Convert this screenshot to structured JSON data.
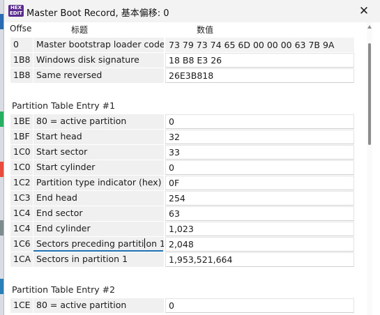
{
  "window": {
    "title": "Master Boot Record, 基本偏移: 0",
    "icon_text_top": "HEX",
    "icon_text_bottom": "EDIT",
    "close_glyph": "✕"
  },
  "columns": {
    "offset": "Offse",
    "label": "标题",
    "value": "数值"
  },
  "header_rows": [
    {
      "offset": "0",
      "label": "Master bootstrap loader code",
      "value": "73 79 73 74 65 6D 00 00 00 63 7B 9A",
      "readonly": true
    },
    {
      "offset": "1B8",
      "label": "Windows disk signature",
      "value": "18 B8 E3 26",
      "readonly": false
    },
    {
      "offset": "1B8",
      "label": "Same reversed",
      "value": "26E3B818",
      "readonly": false
    }
  ],
  "partition1": {
    "title": "Partition Table Entry #1",
    "rows": [
      {
        "offset": "1BE",
        "label": "80 = active partition",
        "value": "0"
      },
      {
        "offset": "1BF",
        "label": "Start head",
        "value": "32"
      },
      {
        "offset": "1C0",
        "label": "Start sector",
        "value": "33"
      },
      {
        "offset": "1C0",
        "label": "Start cylinder",
        "value": "0"
      },
      {
        "offset": "1C2",
        "label": "Partition type indicator (hex)",
        "value": "0F"
      },
      {
        "offset": "1C3",
        "label": "End head",
        "value": "254"
      },
      {
        "offset": "1C4",
        "label": "End sector",
        "value": "63"
      },
      {
        "offset": "1C4",
        "label": "End cylinder",
        "value": "1,023"
      },
      {
        "offset": "1C6",
        "label_a": "Sectors preceding partiti",
        "label_b": "on 1",
        "value": "2,048"
      },
      {
        "offset": "1CA",
        "label": "Sectors in partition 1",
        "value": "1,953,521,664"
      }
    ]
  },
  "partition2": {
    "title": "Partition Table Entry #2",
    "rows": [
      {
        "offset": "1CE",
        "label": "80 = active partition",
        "value": "0"
      }
    ]
  },
  "colors": {
    "accent": "#1f6fb0",
    "label_bg": "#f0f0f0",
    "titlebar_bg": "#f3f3f3"
  }
}
